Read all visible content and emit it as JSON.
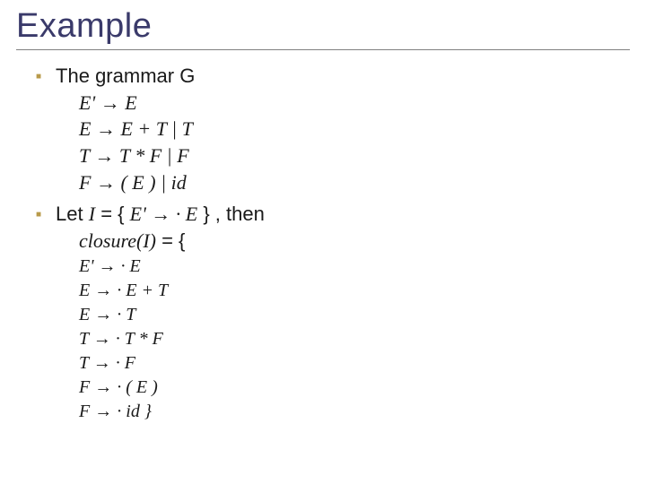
{
  "title": "Example",
  "b1": {
    "lead": "The grammar G",
    "g1": "E' → E",
    "g2": "E  → E + T  |  T",
    "g3": "T  → T * F  |  F",
    "g4": "F  → ( E )  |  id"
  },
  "b2": {
    "lead_pre": "Let  ",
    "lead_I": "I",
    "lead_mid": " = { ",
    "lead_item": "E' →  · E",
    "lead_post": " } , then",
    "closure_lhs": "closure",
    "closure_arg": "(I)",
    "closure_eq": "  =  {",
    "c1": "E' → · E",
    "c2": "E  → · E + T",
    "c3": "E  → · T",
    "c4": "T  → · T * F",
    "c5": "T  → · F",
    "c6": "F  → · ( E )",
    "c7": "F  → · id   }"
  }
}
